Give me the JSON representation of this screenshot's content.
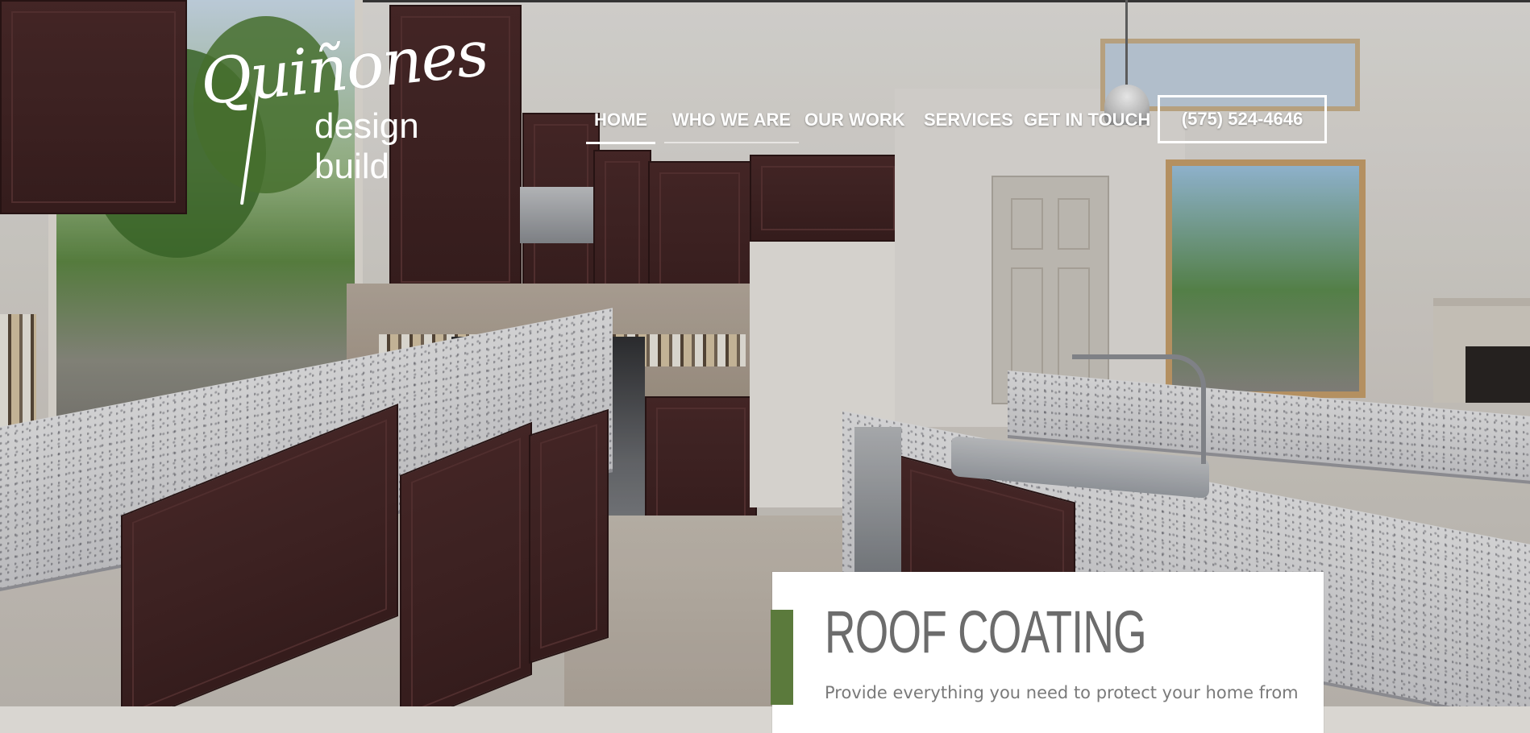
{
  "brand": {
    "logo_script": "Quiñones",
    "logo_sub": "design build"
  },
  "nav": {
    "items": [
      {
        "label": "HOME"
      },
      {
        "label": "WHO WE ARE"
      },
      {
        "label": "OUR WORK"
      },
      {
        "label": "SERVICES"
      },
      {
        "label": "GET IN TOUCH"
      }
    ],
    "phone": "(575) 524-4646"
  },
  "service_card": {
    "title": "ROOF COATING",
    "text": "Provide everything you need to protect your home from"
  },
  "colors": {
    "accent_green": "#5b7a3c",
    "nav_text": "#ffffff",
    "card_title": "#6c6c6c"
  }
}
